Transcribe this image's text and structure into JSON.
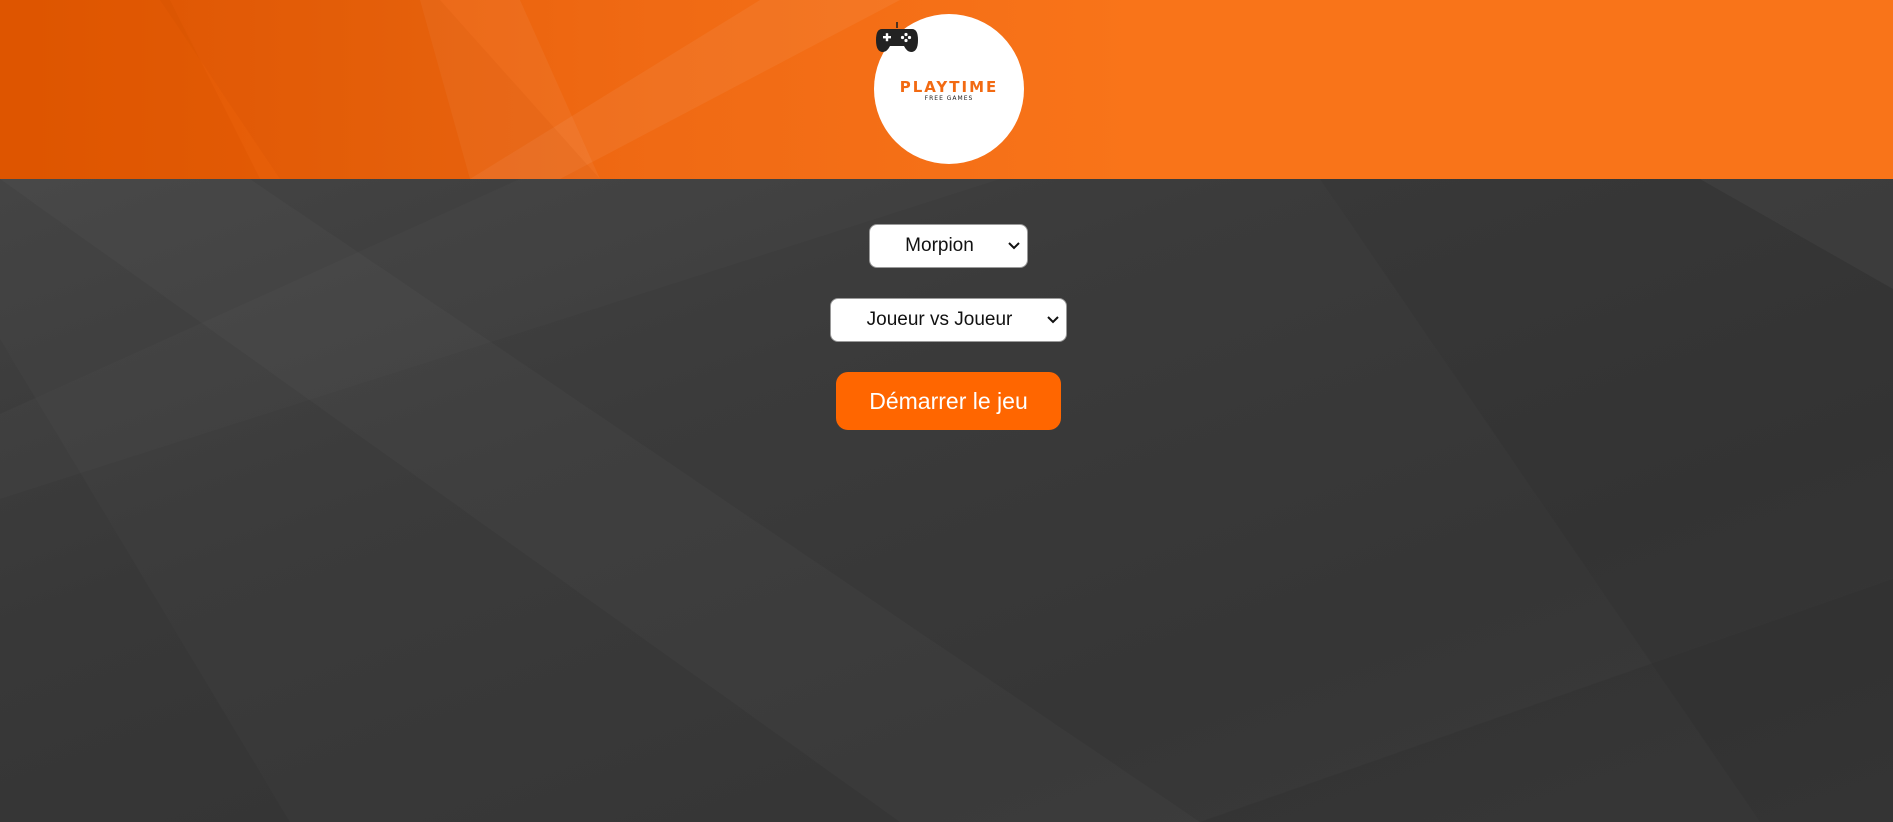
{
  "header": {
    "logo": {
      "title": "PLAYTIME",
      "subtitle": "FREE GAMES",
      "icon": "gamepad-icon"
    }
  },
  "controls": {
    "game_select": {
      "selected": "Morpion",
      "icon": "chevron-down-icon"
    },
    "mode_select": {
      "selected": "Joueur vs Joueur",
      "icon": "chevron-down-icon"
    },
    "start_label": "Démarrer le jeu"
  },
  "colors": {
    "header": "#f97419",
    "background": "#3a3a3a",
    "button": "#ff6600",
    "button_text": "#ffffff"
  }
}
